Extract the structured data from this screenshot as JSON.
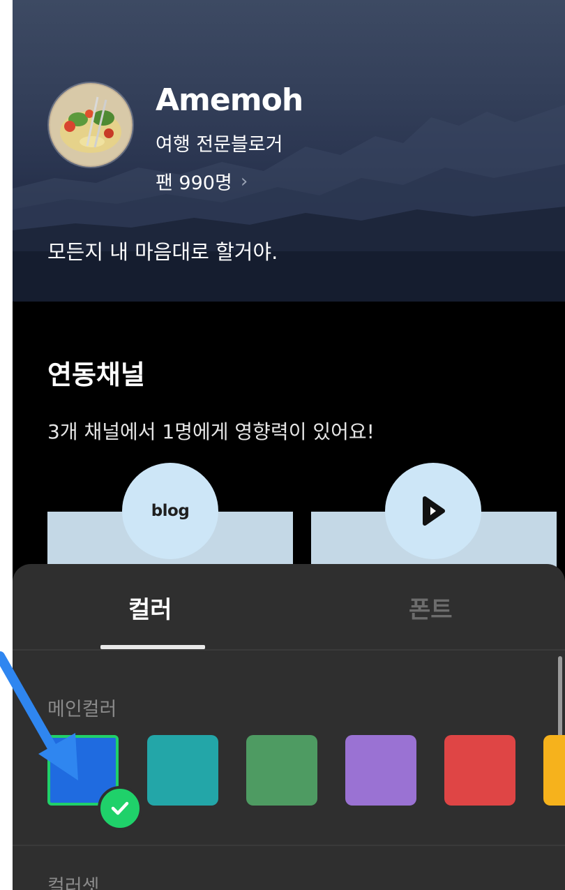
{
  "profile": {
    "name": "Amemoh",
    "subtitle": "여행 전문블로거",
    "fans": "팬 990명",
    "fans_chevron": "›",
    "motto": "모든지 내 마음대로 할거야."
  },
  "channels": {
    "title": "연동채널",
    "description": "3개 채널에서  1명에게 영향력이 있어요!",
    "items": [
      {
        "label": "blog",
        "icon": "blog-text-icon"
      },
      {
        "label": "",
        "icon": "play-icon"
      }
    ]
  },
  "sheet": {
    "tabs": [
      {
        "label": "컬러",
        "active": true
      },
      {
        "label": "폰트",
        "active": false
      }
    ],
    "main_color_label": "메인컬러",
    "swatches": [
      {
        "color": "#1f6be0",
        "selected": true
      },
      {
        "color": "#23a6a8",
        "selected": false
      },
      {
        "color": "#4e9b62",
        "selected": false
      },
      {
        "color": "#9a72d3",
        "selected": false
      },
      {
        "color": "#df4545",
        "selected": false
      },
      {
        "color": "#f6b21c",
        "selected": false
      }
    ],
    "next_section_label": "컬러셋"
  },
  "annotation": {
    "arrow_color": "#2f86f0"
  }
}
